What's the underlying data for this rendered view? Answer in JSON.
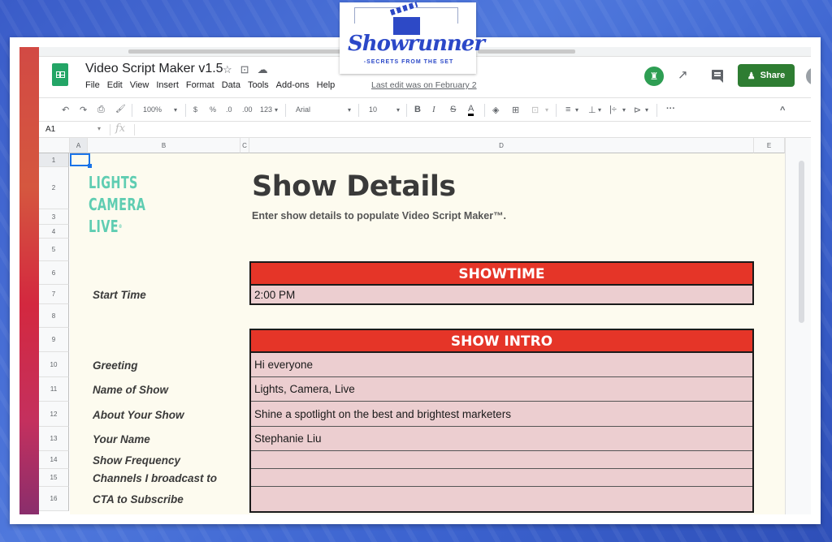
{
  "overlay_logo": {
    "name": "Showrunner",
    "tagline": "-SECRETS FROM THE SET"
  },
  "app": {
    "doc_title": "Video Script Maker v1.5",
    "title_icons": [
      "star-icon",
      "move-to-folder-icon",
      "cloud-saved-icon"
    ],
    "menu": [
      "File",
      "Edit",
      "View",
      "Insert",
      "Format",
      "Data",
      "Tools",
      "Add-ons",
      "Help"
    ],
    "last_edit": "Last edit was on February 2",
    "share_label": "Share",
    "avatar_glyph": "♜",
    "trend_glyph": "↗"
  },
  "toolbar": {
    "undo": "↶",
    "redo": "↷",
    "print": "⎙",
    "paint_format": "🖌",
    "zoom": "100%",
    "currency": "$",
    "percent": "%",
    "decrease_decimal": ".0",
    "increase_decimal": ".00",
    "more_formats": "123",
    "font": "Arial",
    "font_size": "10",
    "bold": "B",
    "italic": "I",
    "strikethrough": "S",
    "text_color": "A",
    "fill": "◈",
    "borders": "⊞",
    "merge": "⊡",
    "h_align": "≡",
    "v_align": "⊥",
    "wrap": "|÷",
    "rotate": "⊳",
    "more": "···",
    "collapse": "^",
    "dropdown": "▾"
  },
  "formula_bar": {
    "cell_ref": "A1",
    "fx": "fx",
    "value": ""
  },
  "columns": [
    "A",
    "B",
    "C",
    "D",
    "E"
  ],
  "rows": [
    "1",
    "2",
    "3",
    "4",
    "5",
    "6",
    "7",
    "8",
    "9",
    "10",
    "11",
    "12",
    "13",
    "14",
    "15",
    "16"
  ],
  "sheet": {
    "brand_lines": [
      "LIGHTS",
      "CAMERA",
      "LIVE"
    ],
    "brand_mark": "®",
    "title": "Show Details",
    "subtitle": "Enter show details to populate Video Script Maker™.",
    "showtime": {
      "header": "SHOWTIME",
      "fields": [
        {
          "label": "Start Time",
          "value": "2:00 PM"
        }
      ]
    },
    "show_intro": {
      "header": "SHOW INTRO",
      "fields": [
        {
          "label": "Greeting",
          "value": "Hi everyone"
        },
        {
          "label": "Name of Show",
          "value": "Lights, Camera, Live"
        },
        {
          "label": "About Your Show",
          "value": "Shine a spotlight on the best and brightest marketers"
        },
        {
          "label": "Your Name",
          "value": "Stephanie Liu"
        },
        {
          "label": "Show Frequency",
          "value": ""
        },
        {
          "label": "Channels I broadcast to",
          "value": ""
        },
        {
          "label": "CTA to Subscribe",
          "value": ""
        }
      ]
    }
  },
  "colors": {
    "header_red": "#e53528",
    "input_pink": "#ecced0",
    "brand_teal": "#5fcdb2",
    "share_green": "#2e7d32",
    "sheet_bg": "#fdfbef"
  }
}
